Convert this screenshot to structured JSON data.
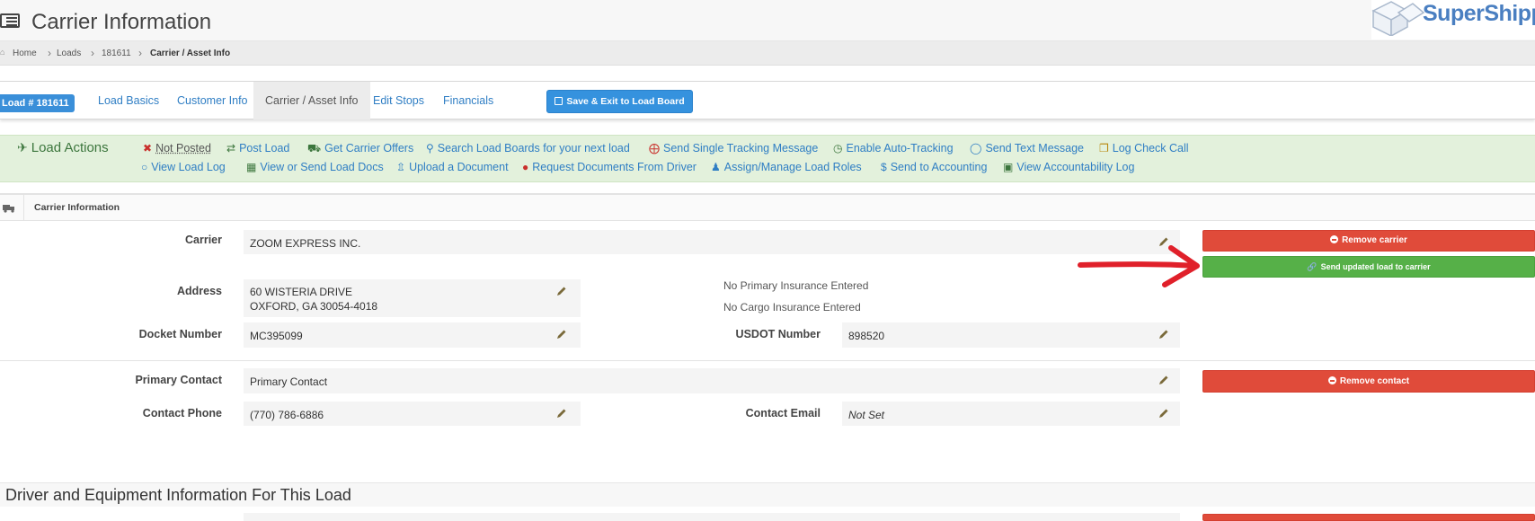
{
  "header": {
    "title": "Carrier Information",
    "logo_text": "SuperShipp"
  },
  "breadcrumb": [
    "Home",
    "Loads",
    "181611",
    "Carrier / Asset Info"
  ],
  "tabs": {
    "load_badge": "Load # 181611",
    "items": [
      "Load Basics",
      "Customer Info",
      "Carrier / Asset Info",
      "Edit Stops",
      "Financials"
    ],
    "active": "Carrier / Asset Info",
    "save_exit": "Save & Exit to Load Board"
  },
  "load_actions": {
    "title": "Load Actions",
    "row1": [
      "Not Posted",
      "Post Load",
      "Get Carrier Offers",
      "Search Load Boards for your next load",
      "Send Single Tracking Message",
      "Enable Auto-Tracking",
      "Send Text Message",
      "Log Check Call"
    ],
    "row2": [
      "View Load Log",
      "View or Send Load Docs",
      "Upload a Document",
      "Request Documents From Driver",
      "Assign/Manage Load Roles",
      "Send to Accounting",
      "View Accountability Log"
    ]
  },
  "section": {
    "title": "Carrier Information"
  },
  "carrier": {
    "carrier_label": "Carrier",
    "carrier_value": "ZOOM EXPRESS INC.",
    "address_label": "Address",
    "address_line1": "60 WISTERIA DRIVE",
    "address_line2": "OXFORD, GA 30054-4018",
    "no_primary_insurance": "No Primary Insurance Entered",
    "no_cargo_insurance": "No Cargo Insurance Entered",
    "docket_label": "Docket Number",
    "docket_value": "MC395099",
    "usdot_label": "USDOT Number",
    "usdot_value": "898520",
    "remove_carrier": "Remove carrier",
    "send_updated": "Send updated load to carrier"
  },
  "contact": {
    "primary_label": "Primary Contact",
    "primary_value": "Primary Contact",
    "phone_label": "Contact Phone",
    "phone_value": "(770) 786-6886",
    "email_label": "Contact Email",
    "email_value": "Not Set",
    "remove_contact": "Remove contact"
  },
  "driver_section": {
    "title": "Driver and Equipment Information For This Load"
  },
  "colors": {
    "link_blue": "#2f7ec4",
    "primary_blue": "#3592de",
    "danger_red": "#e04b3a",
    "success_green": "#56b048",
    "actions_bg": "#e3f1dc",
    "actions_title": "#3c763d",
    "annotation_arrow": "#e0202a"
  }
}
